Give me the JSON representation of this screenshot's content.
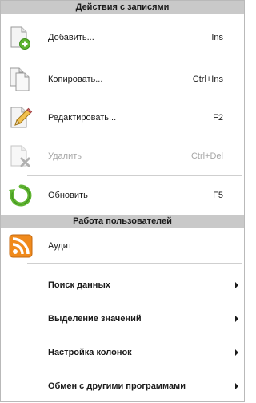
{
  "sections": {
    "records_header": "Действия с записями",
    "users_header": "Работа пользователей"
  },
  "items": {
    "add": {
      "label": "Добавить...",
      "shortcut": "Ins",
      "icon": "add-document-icon"
    },
    "copy": {
      "label": "Копировать...",
      "shortcut": "Ctrl+Ins",
      "icon": "copy-documents-icon"
    },
    "edit": {
      "label": "Редактировать...",
      "shortcut": "F2",
      "icon": "edit-document-icon"
    },
    "delete": {
      "label": "Удалить",
      "shortcut": "Ctrl+Del",
      "icon": "delete-document-icon",
      "disabled": true
    },
    "refresh": {
      "label": "Обновить",
      "shortcut": "F5",
      "icon": "refresh-icon"
    },
    "audit": {
      "label": "Аудит",
      "icon": "rss-icon"
    }
  },
  "submenus": [
    {
      "label": "Поиск данных"
    },
    {
      "label": "Выделение значений"
    },
    {
      "label": "Настройка колонок"
    },
    {
      "label": "Обмен с другими программами"
    }
  ],
  "colors": {
    "header_bg": "#c9c9c9",
    "disabled_text": "#a7a7a7",
    "green": "#5fb431",
    "orange": "#f08a1c"
  }
}
